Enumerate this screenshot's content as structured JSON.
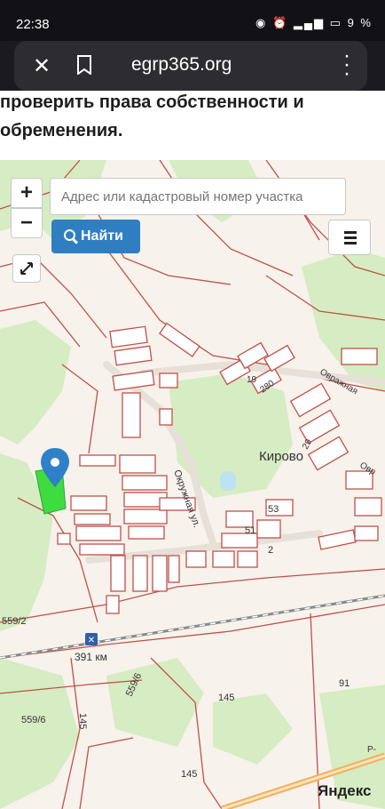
{
  "status_bar": {
    "time": "22:38",
    "battery": "9 %"
  },
  "browser": {
    "url": "egrp365.org",
    "close_icon": "close-icon",
    "bookmark_icon": "bookmark-icon",
    "menu_icon": "more-vert-icon"
  },
  "page": {
    "heading_line1": "проверить права собственности и",
    "heading_line2": "обременения."
  },
  "map": {
    "zoom_in_label": "+",
    "zoom_out_label": "−",
    "search_placeholder": "Адрес или кадастровый номер участка",
    "find_button_label": "Найти",
    "village_label": "Кирово",
    "street_label": "Окружная ул.",
    "street_label_2": "Овражная",
    "street_label_3": "Овр",
    "station_label": "391 км",
    "highway_label": "Р-",
    "parcel_labels": [
      "19",
      "280",
      "29",
      "53",
      "51",
      "2",
      "559/2",
      "559/6",
      "559/6",
      "145",
      "145",
      "145",
      "91"
    ],
    "attribution": "Яндекс",
    "colors": {
      "parcel_border": "#c0504a",
      "forest": "#d6ecc2",
      "field": "#f7f2ec",
      "selected_parcel": "#3fdc3f",
      "marker": "#2f80c9",
      "button": "#2f7ec2"
    }
  }
}
